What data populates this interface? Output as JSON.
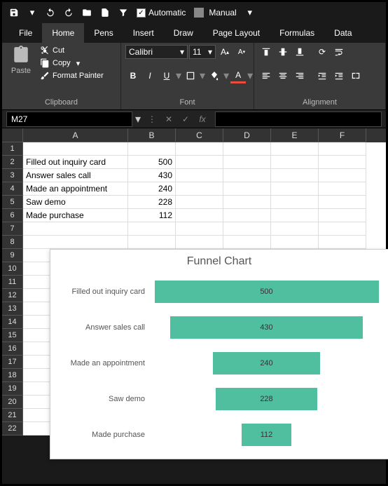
{
  "qat": {
    "automatic_label": "Automatic",
    "manual_label": "Manual",
    "automatic_checked": true
  },
  "tabs": [
    "File",
    "Home",
    "Pens",
    "Insert",
    "Draw",
    "Page Layout",
    "Formulas",
    "Data"
  ],
  "active_tab": "Home",
  "ribbon": {
    "clipboard": {
      "paste": "Paste",
      "cut": "Cut",
      "copy": "Copy",
      "format_painter": "Format Painter",
      "group_label": "Clipboard"
    },
    "font": {
      "name": "Calibri",
      "size": "11",
      "group_label": "Font"
    },
    "alignment": {
      "group_label": "Alignment"
    }
  },
  "namebox": "M27",
  "columns": [
    "A",
    "B",
    "C",
    "D",
    "E",
    "F"
  ],
  "rows_count": 22,
  "sheet": {
    "r2": {
      "a": "Filled out inquiry card",
      "b": "500"
    },
    "r3": {
      "a": "Answer sales call",
      "b": "430"
    },
    "r4": {
      "a": "Made an appointment",
      "b": "240"
    },
    "r5": {
      "a": "Saw demo",
      "b": "228"
    },
    "r6": {
      "a": "Made purchase",
      "b": "112"
    }
  },
  "chart_data": {
    "type": "bar",
    "title": "Funnel Chart",
    "categories": [
      "Filled out inquiry card",
      "Answer sales call",
      "Made an appointment",
      "Saw demo",
      "Made purchase"
    ],
    "values": [
      500,
      430,
      240,
      228,
      112
    ],
    "xlabel": "",
    "ylabel": "",
    "ylim": [
      0,
      500
    ],
    "orientation": "horizontal-centered"
  }
}
